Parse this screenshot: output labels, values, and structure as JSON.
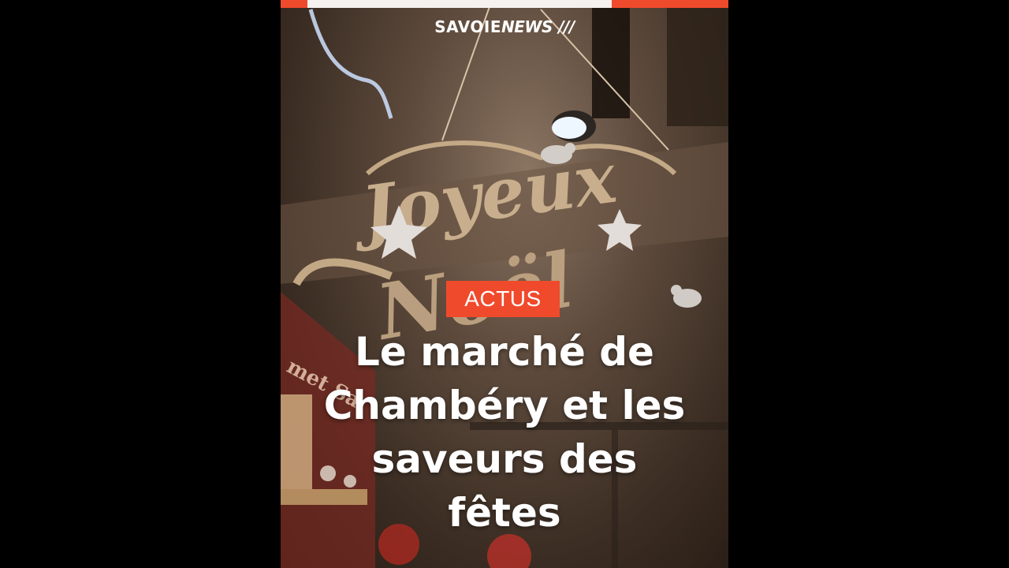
{
  "header": {
    "logo_main": "SAVOIE",
    "logo_accent": "NEWS",
    "logo_slashes": "///"
  },
  "progress": {
    "left_fill_fraction": 0.06,
    "right_fill_fraction": 0.26
  },
  "background": {
    "sign_text_1": "Joyeux",
    "sign_text_2": "Noël",
    "wall_text": "met Sa"
  },
  "story": {
    "category": "ACTUS",
    "headline_lines": [
      "Le marché de",
      "Chambéry et les",
      "saveurs des",
      "fêtes"
    ]
  },
  "colors": {
    "accent": "#f04a2c",
    "text": "#ffffff",
    "letterbox": "#000000"
  }
}
